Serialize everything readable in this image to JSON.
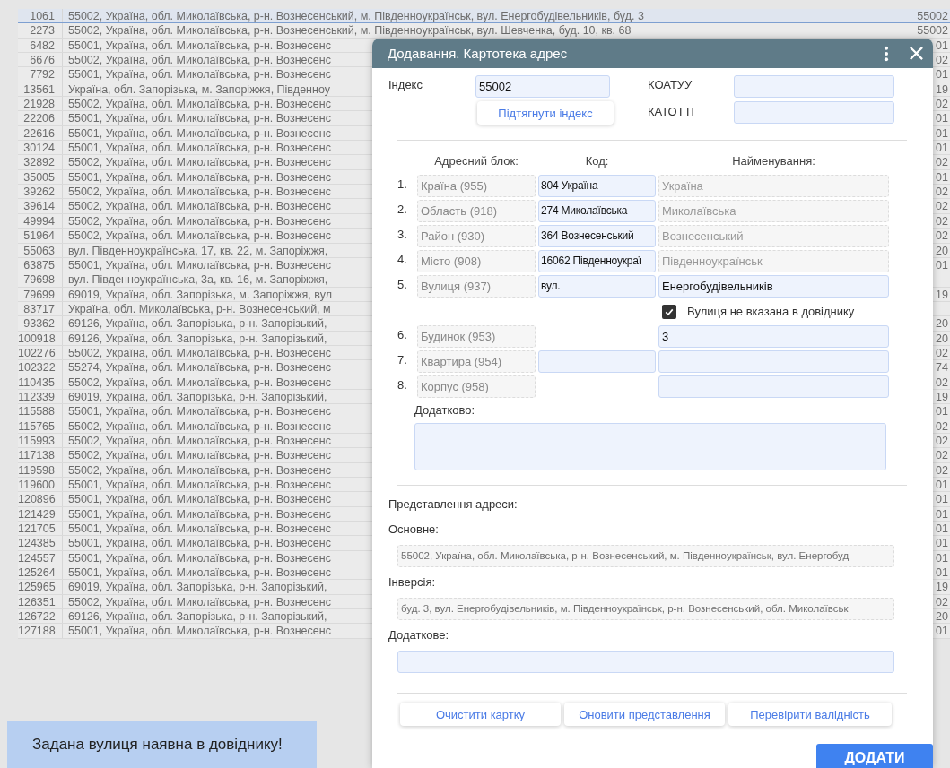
{
  "table": {
    "rows": [
      {
        "number": "1061",
        "address": "55002, Україна, обл. Миколаївська, р-н. Вознесенський, м. Південноукраїнськ, вул. Енергобудівельників, буд. 3",
        "column_3": "55002",
        "selected": true
      },
      {
        "number": "2273",
        "address": "55002, Україна, обл. Миколаївська, р-н. Вознесенський, м. Південноукраїнськ, вул. Шевченка, буд. 10, кв. 68",
        "column_3": "55002",
        "selected": false
      },
      {
        "number": "6482",
        "address": "55001, Україна, обл. Миколаївська, р-н. Вознесенс",
        "column_3": "01",
        "selected": false
      },
      {
        "number": "6676",
        "address": "55002, Україна, обл. Миколаївська, р-н. Вознесенс",
        "column_3": "02",
        "selected": false
      },
      {
        "number": "7792",
        "address": "55001, Україна, обл. Миколаївська, р-н. Вознесенс",
        "column_3": "01",
        "selected": false
      },
      {
        "number": "13561",
        "address": "Україна, обл. Запорізька, м. Запоріжжя, Південноу",
        "column_3": "19",
        "selected": false
      },
      {
        "number": "21928",
        "address": "55002, Україна, обл. Миколаївська, р-н. Вознесенс",
        "column_3": "02",
        "selected": false
      },
      {
        "number": "22206",
        "address": "55001, Україна, обл. Миколаївська, р-н. Вознесенс",
        "column_3": "01",
        "selected": false
      },
      {
        "number": "22616",
        "address": "55001, Україна, обл. Миколаївська, р-н. Вознесенс",
        "column_3": "01",
        "selected": false
      },
      {
        "number": "30124",
        "address": "55001, Україна, обл. Миколаївська, р-н. Вознесенс",
        "column_3": "01",
        "selected": false
      },
      {
        "number": "32892",
        "address": "55002, Україна, обл. Миколаївська, р-н. Вознесенс",
        "column_3": "02",
        "selected": false
      },
      {
        "number": "35005",
        "address": "55001, Україна, обл. Миколаївська, р-н. Вознесенс",
        "column_3": "01",
        "selected": false
      },
      {
        "number": "39262",
        "address": "55002, Україна, обл. Миколаївська, р-н. Вознесенс",
        "column_3": "02",
        "selected": false
      },
      {
        "number": "39614",
        "address": "55002, Україна, обл. Миколаївська, р-н. Вознесенс",
        "column_3": "02",
        "selected": false
      },
      {
        "number": "49994",
        "address": "55002, Україна, обл. Миколаївська, р-н. Вознесенс",
        "column_3": "02",
        "selected": false
      },
      {
        "number": "51964",
        "address": "55002, Україна, обл. Миколаївська, р-н. Вознесенс",
        "column_3": "02",
        "selected": false
      },
      {
        "number": "55063",
        "address": "вул. Південноукраїнська, 17, кв. 22, м. Запоріжжя,",
        "column_3": "20",
        "selected": false
      },
      {
        "number": "63875",
        "address": "55001, Україна, обл. Миколаївська, р-н. Вознесенс",
        "column_3": "01",
        "selected": false
      },
      {
        "number": "79698",
        "address": "вул. Південноукраїнська, 3а, кв. 16, м. Запоріжжя,",
        "selected": false
      },
      {
        "number": "79699",
        "address": "69019, Україна, обл. Запорізька, м. Запоріжжя, вул",
        "column_3": "19",
        "selected": false
      },
      {
        "number": "83717",
        "address": "Україна, обл. Миколаївська, р-н. Вознесенський, м",
        "selected": false
      },
      {
        "number": "93362",
        "address": "69126, Україна, обл. Запорізька, р-н. Запорізький,",
        "column_3": "20",
        "selected": false
      },
      {
        "number": "100918",
        "address": "69126, Україна, обл. Запорізька, р-н. Запорізький,",
        "column_3": "20",
        "selected": false
      },
      {
        "number": "102276",
        "address": "55002, Україна, обл. Миколаївська, р-н. Вознесенс",
        "column_3": "02",
        "selected": false
      },
      {
        "number": "102322",
        "address": "55274, Україна, обл. Миколаївська, р-н. Вознесенс",
        "column_3": "74",
        "selected": false
      },
      {
        "number": "110435",
        "address": "55002, Україна, обл. Миколаївська, р-н. Вознесенс",
        "column_3": "02",
        "selected": false
      },
      {
        "number": "112339",
        "address": "69019, Україна, обл. Запорізька, р-н. Запорізький,",
        "column_3": "19",
        "selected": false
      },
      {
        "number": "115588",
        "address": "55001, Україна, обл. Миколаївська, р-н. Вознесенс",
        "column_3": "01",
        "selected": false
      },
      {
        "number": "115765",
        "address": "55002, Україна, обл. Миколаївська, р-н. Вознесенс",
        "column_3": "02",
        "selected": false
      },
      {
        "number": "115993",
        "address": "55002, Україна, обл. Миколаївська, р-н. Вознесенс",
        "column_3": "02",
        "selected": false
      },
      {
        "number": "117138",
        "address": "55002, Україна, обл. Миколаївська, р-н. Вознесенс",
        "column_3": "02",
        "selected": false
      },
      {
        "number": "119598",
        "address": "55002, Україна, обл. Миколаївська, р-н. Вознесенс",
        "column_3": "02",
        "selected": false
      },
      {
        "number": "119600",
        "address": "55001, Україна, обл. Миколаївська, р-н. Вознесенс",
        "column_3": "01",
        "selected": false
      },
      {
        "number": "120896",
        "address": "55001, Україна, обл. Миколаївська, р-н. Вознесенс",
        "column_3": "01",
        "selected": false
      },
      {
        "number": "121429",
        "address": "55001, Україна, обл. Миколаївська, р-н. Вознесенс",
        "column_3": "01",
        "selected": false
      },
      {
        "number": "121705",
        "address": "55001, Україна, обл. Миколаївська, р-н. Вознесенс",
        "column_3": "01",
        "selected": false
      },
      {
        "number": "124385",
        "address": "55001, Україна, обл. Миколаївська, р-н. Вознесенс",
        "column_3": "01",
        "selected": false
      },
      {
        "number": "124557",
        "address": "55001, Україна, обл. Миколаївська, р-н. Вознесенс",
        "column_3": "01",
        "selected": false
      },
      {
        "number": "125264",
        "address": "55001, Україна, обл. Миколаївська, р-н. Вознесенс",
        "column_3": "01",
        "selected": false
      },
      {
        "number": "125965",
        "address": "69019, Україна, обл. Запорізька, р-н. Запорізький,",
        "column_3": "19",
        "selected": false
      },
      {
        "number": "126351",
        "address": "55002, Україна, обл. Миколаївська, р-н. Вознесенс",
        "column_3": "02",
        "selected": false
      },
      {
        "number": "126722",
        "address": "69126, Україна, обл. Запорізька, р-н. Запорізький,",
        "column_3": "20",
        "selected": false
      },
      {
        "number": "127188",
        "address": "55001, Україна, обл. Миколаївська, р-н. Вознесенс",
        "column_3": "01",
        "selected": false
      }
    ]
  },
  "dialog": {
    "title": "Додавання. Картотека адрес",
    "index": {
      "label": "Індекс",
      "value": "55002"
    },
    "fetch_index_button": "Підтягнути індекс",
    "koatuu": {
      "label": "КОАТУУ"
    },
    "katottg": {
      "label": "КАТОТТГ"
    },
    "columns": [
      "Адресний блок:",
      "Код:",
      "Найменування:"
    ],
    "address_rows": [
      {
        "number": "1.",
        "block": "Країна (955)",
        "code_field": true,
        "code": "804 Україна",
        "name_readonly": true,
        "name": "Україна"
      },
      {
        "number": "2.",
        "block": "Область (918)",
        "code_field": true,
        "code": "274 Миколаївська",
        "name_readonly": true,
        "name": "Миколаївська"
      },
      {
        "number": "3.",
        "block": "Район (930)",
        "code_field": true,
        "code": "364 Вознесенський",
        "name_readonly": true,
        "name": "Вознесенський"
      },
      {
        "number": "4.",
        "block": "Місто (908)",
        "code_field": true,
        "code": "16062 Південноукраї",
        "name_readonly": true,
        "name": "Південноукраїнськ"
      },
      {
        "number": "5.",
        "block": "Вулиця (937)",
        "code_field": true,
        "code": "вул.",
        "name_readonly": false,
        "name": "Енергобудівельників"
      }
    ],
    "street_checkbox": {
      "label": "Вулиця не вказана в довіднику",
      "checked": true
    },
    "house_rows": [
      {
        "number": "6.",
        "block": "Будинок (953)",
        "code_field": false,
        "name_readonly": false,
        "name": "3"
      },
      {
        "number": "7.",
        "block": "Квартира (954)",
        "code_field": true,
        "name_readonly": false
      },
      {
        "number": "8.",
        "block": "Корпус (958)",
        "code_field": false,
        "name_readonly": false
      }
    ],
    "additional_label": "Додатково:",
    "representation_label": "Представлення адреси:",
    "main": {
      "label": "Основне:",
      "value": "55002, Україна, обл. Миколаївська, р-н. Вознесенський, м. Південноукраїнськ, вул. Енергобуд"
    },
    "inversion": {
      "label": "Інверсія:",
      "value": "буд. 3, вул. Енергобудівельників, м. Південноукраїнськ, р-н. Вознесенський, обл. Миколаївськ"
    },
    "extra": {
      "label": "Додаткове:"
    },
    "buttons": [
      "Очистити картку",
      "Оновити представлення",
      "Перевірити валідність"
    ],
    "submit": "ДОДАТИ"
  },
  "toast": "Задана вулиця наявна в довіднику!"
}
